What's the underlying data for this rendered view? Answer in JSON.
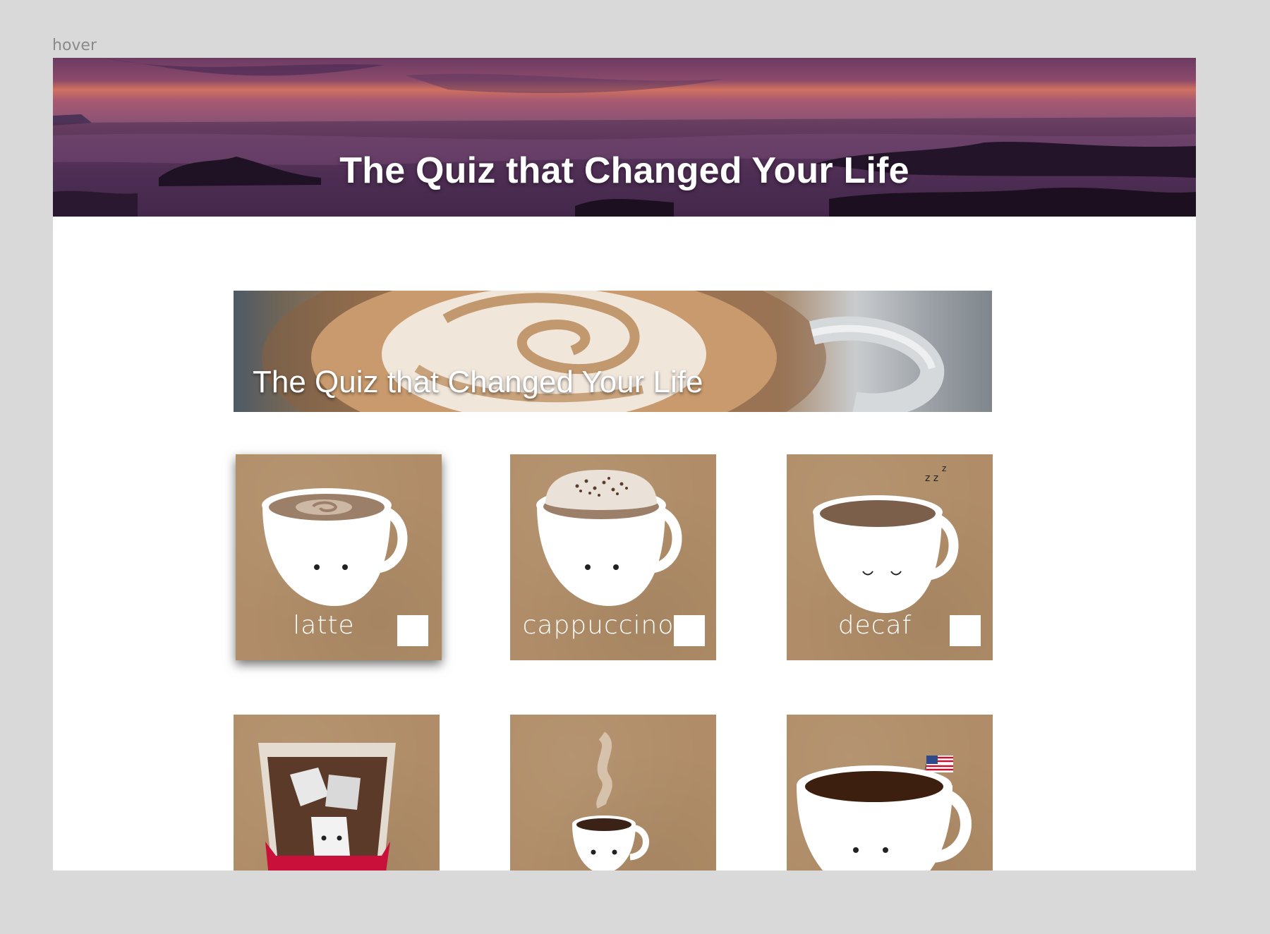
{
  "state_label": "hover",
  "header": {
    "title": "The Quiz that Changed Your Life"
  },
  "banner": {
    "title": "The Quiz that Changed Your Life"
  },
  "cards": [
    {
      "label": "latte"
    },
    {
      "label": "cappuccino"
    },
    {
      "label": "decaf"
    },
    {
      "label": ""
    },
    {
      "label": ""
    },
    {
      "label": ""
    }
  ],
  "colors": {
    "page_bg": "#d9d9d9",
    "card_bg": "#b08d68",
    "accent_red": "#c8103a"
  }
}
